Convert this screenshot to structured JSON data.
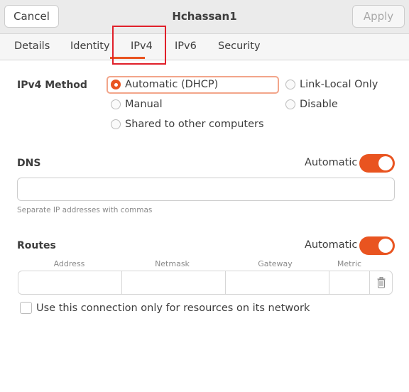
{
  "header": {
    "cancel_label": "Cancel",
    "title": "Hchassan1",
    "apply_label": "Apply"
  },
  "tabs": [
    {
      "label": "Details"
    },
    {
      "label": "Identity"
    },
    {
      "label": "IPv4",
      "selected": true
    },
    {
      "label": "IPv6"
    },
    {
      "label": "Security"
    }
  ],
  "ipv4_method": {
    "label": "IPv4 Method",
    "options": [
      {
        "label": "Automatic (DHCP)",
        "selected": true
      },
      {
        "label": "Link-Local Only",
        "selected": false
      },
      {
        "label": "Manual",
        "selected": false
      },
      {
        "label": "Disable",
        "selected": false
      },
      {
        "label": "Shared to other computers",
        "selected": false
      }
    ]
  },
  "dns": {
    "label": "DNS",
    "automatic_label": "Automatic",
    "automatic_on": true,
    "value": "",
    "hint": "Separate IP addresses with commas"
  },
  "routes": {
    "label": "Routes",
    "automatic_label": "Automatic",
    "automatic_on": true,
    "columns": [
      "Address",
      "Netmask",
      "Gateway",
      "Metric"
    ],
    "row": {
      "address": "",
      "netmask": "",
      "gateway": "",
      "metric": ""
    }
  },
  "only_local": {
    "label": "Use this connection only for resources on its network",
    "checked": false
  },
  "colors": {
    "accent": "#e95420",
    "highlight_box": "#e0202a"
  }
}
